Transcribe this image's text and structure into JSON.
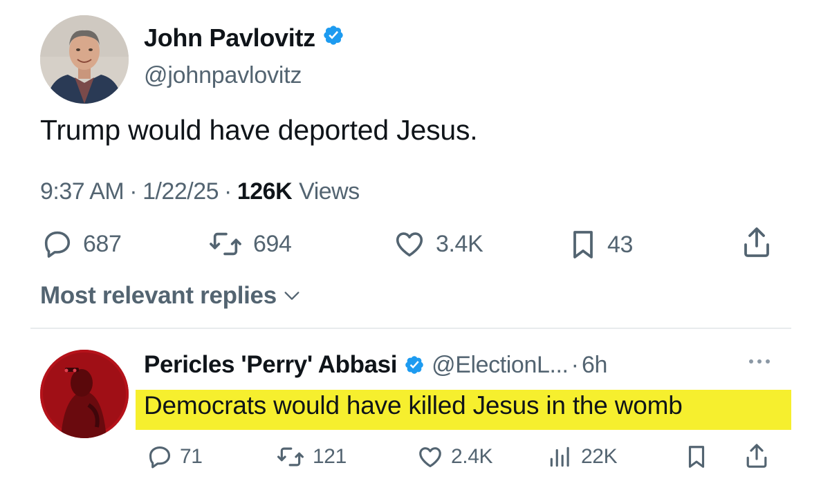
{
  "tweet": {
    "author": {
      "name": "John Pavlovitz",
      "handle": "@johnpavlovitz",
      "verified": true
    },
    "text": "Trump would have deported Jesus.",
    "time": "9:37 AM",
    "date": "1/22/25",
    "views_count": "126K",
    "views_label": "Views",
    "separator": "·",
    "stats": {
      "replies": "687",
      "reposts": "694",
      "likes": "3.4K",
      "bookmarks": "43"
    }
  },
  "replies_section": {
    "sort_label": "Most relevant replies"
  },
  "reply": {
    "author": {
      "name": "Pericles 'Perry' Abbasi",
      "handle": "@ElectionL...",
      "verified": true
    },
    "separator": "·",
    "time": "6h",
    "text": "Democrats would have killed Jesus in the womb",
    "highlight_color": "#f6ef2e",
    "stats": {
      "replies": "71",
      "reposts": "121",
      "likes": "2.4K",
      "views": "22K"
    }
  },
  "colors": {
    "verified_blue": "#1d9bf0",
    "secondary_text": "#536471",
    "primary_text": "#0f1419"
  },
  "icons": [
    "verified-badge-icon",
    "reply-icon",
    "repost-icon",
    "like-icon",
    "bookmark-icon",
    "share-icon",
    "chevron-down-icon",
    "more-icon",
    "views-icon"
  ]
}
